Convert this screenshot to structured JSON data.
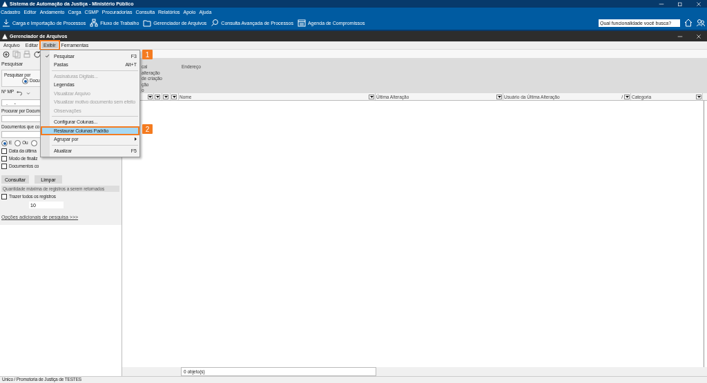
{
  "window": {
    "title": "Sistema de Automação da Justiça - Ministério Público"
  },
  "menu": [
    "Cadastro",
    "Editor",
    "Andamento",
    "Carga",
    "CSMP",
    "Procuradorias",
    "Consulta",
    "Relatórios",
    "Apoio",
    "Ajuda"
  ],
  "toolbar": [
    "Carga e Importação de Processos",
    "Fluxo de Trabalho",
    "Gerenciador de Arquivos",
    "Consulta Avançada de Processos",
    "Agenda de Compromissos"
  ],
  "search": {
    "value": "Qual funcionalidade você busca?"
  },
  "child_window": {
    "title": "Gerenciador de Arquivos",
    "menu": [
      {
        "label": "Arquivo",
        "selected": false,
        "highlighted": false
      },
      {
        "label": "Editar",
        "selected": false,
        "highlighted": false
      },
      {
        "label": "Exibir",
        "selected": true,
        "highlighted": true
      },
      {
        "label": "Ferramentas",
        "selected": false,
        "highlighted": false
      }
    ]
  },
  "view_menu": [
    {
      "kind": "item",
      "label": "Pesquisar",
      "shortcut": "F3",
      "checked": true,
      "disabled": false,
      "selected": false,
      "submenu": false,
      "highlighted": false
    },
    {
      "kind": "item",
      "label": "Pastas",
      "shortcut": "Alt+T",
      "checked": false,
      "disabled": false,
      "selected": false,
      "submenu": false,
      "highlighted": false
    },
    {
      "kind": "separator"
    },
    {
      "kind": "item",
      "label": "Assinaturas Digitais...",
      "checked": false,
      "disabled": true,
      "selected": false,
      "submenu": false,
      "highlighted": false
    },
    {
      "kind": "item",
      "label": "Legendas",
      "checked": false,
      "disabled": false,
      "selected": false,
      "submenu": false,
      "highlighted": false
    },
    {
      "kind": "item",
      "label": "Visualizar Arquivo",
      "checked": false,
      "disabled": true,
      "selected": false,
      "submenu": false,
      "highlighted": false
    },
    {
      "kind": "item",
      "label": "Visualizar motivo documento sem efeito",
      "checked": false,
      "disabled": true,
      "selected": false,
      "submenu": false,
      "highlighted": false
    },
    {
      "kind": "item",
      "label": "Observações",
      "checked": false,
      "disabled": true,
      "selected": false,
      "submenu": false,
      "highlighted": false
    },
    {
      "kind": "separator"
    },
    {
      "kind": "item",
      "label": "Configurar Colunas...",
      "checked": false,
      "disabled": false,
      "selected": false,
      "submenu": false,
      "highlighted": false
    },
    {
      "kind": "item",
      "label": "Restaurar Colunas Padrão",
      "checked": false,
      "disabled": false,
      "selected": true,
      "submenu": false,
      "highlighted": true
    },
    {
      "kind": "item",
      "label": "Agrupar por",
      "checked": false,
      "disabled": false,
      "selected": false,
      "submenu": true,
      "highlighted": false
    },
    {
      "kind": "separator"
    },
    {
      "kind": "item",
      "label": "Atualizar",
      "shortcut": "F5",
      "checked": false,
      "disabled": false,
      "selected": false,
      "submenu": false,
      "highlighted": false
    }
  ],
  "callouts": [
    {
      "label": "1"
    },
    {
      "label": "2"
    }
  ],
  "search_panel": {
    "header": "Pesquisar",
    "group_label": "Pesquisar por",
    "search_by": [
      {
        "label": "Docu",
        "selected": true
      }
    ],
    "mp_label": "Nº MP",
    "mp_value": "  .     -",
    "doc_label": "Procurar por Docum",
    "docs_label": "Documentos que co",
    "logic": [
      {
        "label": "E",
        "selected": true
      },
      {
        "label": "Ou",
        "selected": false
      },
      {
        "selected": false
      }
    ],
    "filters": [
      {
        "label": "Data da última",
        "checked": false
      },
      {
        "label": "Modo de finaliz",
        "checked": false
      },
      {
        "label": "Documentos co",
        "checked": false
      }
    ],
    "buttons": [
      "Consultar",
      "Limpar"
    ],
    "limit_header": "Quantidade máxima de registros a serem retornados",
    "all_records": {
      "label": "Trazer todos os registros",
      "checked": false
    },
    "limit": "10",
    "more_link": "Opções adicionais de pesquisa >>>"
  },
  "grouping": {
    "column_1": [
      "cal",
      "alteração",
      "de criação",
      "ção",
      "o"
    ],
    "column_2": [
      "Endereço"
    ]
  },
  "columns": [
    {
      "kind": "narrow"
    },
    {
      "kind": "narrow"
    },
    {
      "kind": "narrow"
    },
    {
      "kind": "narrow"
    },
    {
      "kind": "named",
      "label": "Nome"
    },
    {
      "kind": "named",
      "label": "Última Alteração"
    },
    {
      "kind": "named",
      "label": "Usuário da Última Alteração",
      "mark": "/"
    },
    {
      "kind": "named",
      "label": "Categoria"
    }
  ],
  "result_count": "0 objeto(s)",
  "status_bar": "Unico / Promotoria de Justiça de TESTES"
}
